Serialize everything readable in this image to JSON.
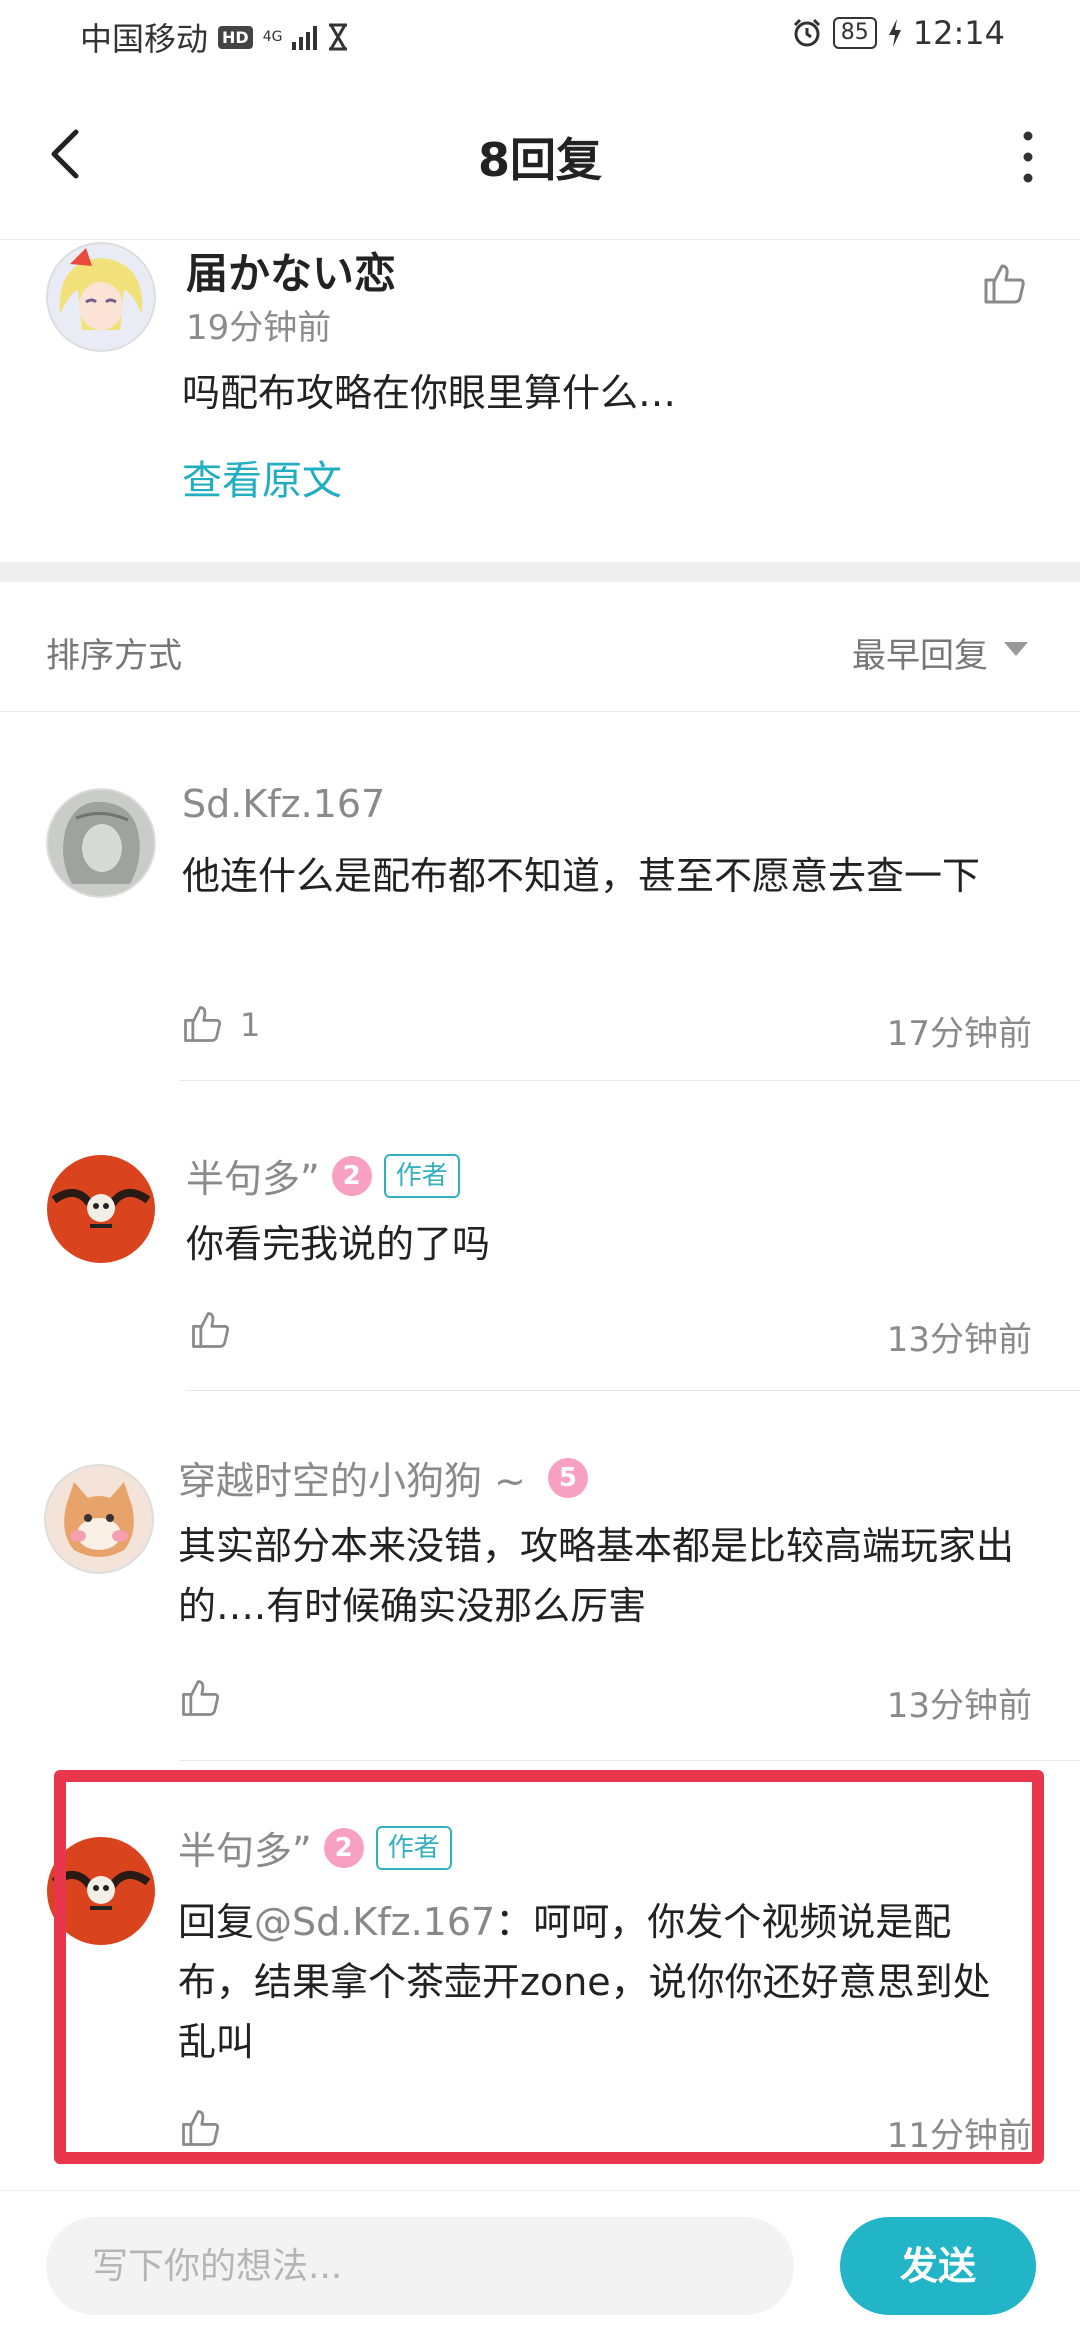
{
  "status_bar": {
    "carrier": "中国移动",
    "hd": "HD",
    "network": "4G",
    "battery": "85",
    "time": "12:14"
  },
  "header": {
    "title": "8回复"
  },
  "original_post": {
    "author": "届かない恋",
    "time": "19分钟前",
    "text": "吗配布攻略在你眼里算什么…",
    "view_original": "查看原文"
  },
  "sort": {
    "label": "排序方式",
    "value": "最早回复"
  },
  "replies": [
    {
      "author": "Sd.Kfz.167",
      "text": "他连什么是配布都不知道，甚至不愿意去查一下",
      "likes": "1",
      "time": "17分钟前"
    },
    {
      "author": "半句多”",
      "level": "2",
      "badge": "作者",
      "text": "你看完我说的了吗",
      "time": "13分钟前"
    },
    {
      "author": "穿越时空的小狗狗 ~",
      "level": "5",
      "text": "其实部分本来没错，攻略基本都是比较高端玩家出的….有时候确实没那么厉害",
      "time": "13分钟前"
    },
    {
      "author": "半句多”",
      "level": "2",
      "badge": "作者",
      "reply_prefix": "回复",
      "mention": "@Sd.Kfz.167",
      "text": "：呵呵，你发个视频说是配布，结果拿个茶壶开zone，说你你还好意思到处乱叫",
      "time": "11分钟前"
    }
  ],
  "input_bar": {
    "placeholder": "写下你的想法...",
    "send_label": "发送"
  },
  "colors": {
    "accent": "#22b4c7",
    "link": "#20aec0",
    "highlight": "#e8374c",
    "level_badge": "#f8a0c0"
  }
}
